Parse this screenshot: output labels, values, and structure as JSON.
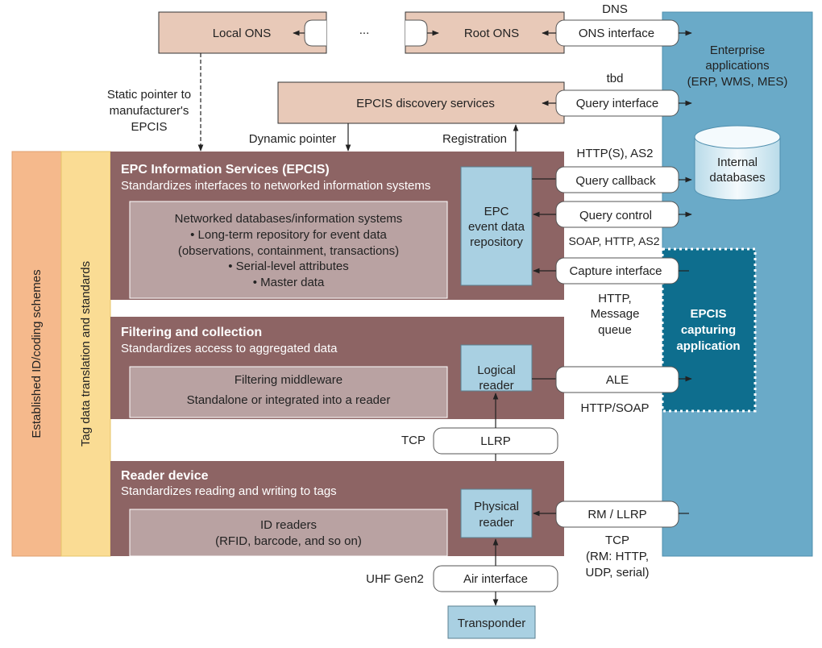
{
  "colors": {
    "ons_box": "#e8c9b8",
    "layer": "#8d6464",
    "inner_box": "#b9a2a2",
    "light_blue": "#a9d0e2",
    "enterprise_panel": "#6aaac8",
    "capturing_app": "#0e6e8e",
    "id_schemes_strip": "#f5b98c",
    "tag_translation_strip": "#fadc94"
  },
  "top": {
    "local_ons": "Local ONS",
    "ellipsis": "...",
    "root_ons": "Root ONS",
    "dns": "DNS",
    "ons_interface": "ONS interface",
    "discovery": "EPCIS discovery services",
    "tbd": "tbd",
    "query_interface": "Query interface",
    "static_pointer": [
      "Static pointer to",
      "manufacturer's",
      "EPCIS"
    ],
    "dynamic_pointer": "Dynamic pointer",
    "registration": "Registration"
  },
  "enterprise": {
    "lines": [
      "Enterprise",
      "applications",
      "(ERP, WMS, MES)"
    ],
    "internal_db": [
      "Internal",
      "databases"
    ],
    "capturing_app": [
      "EPCIS",
      "capturing",
      "application"
    ]
  },
  "side_strips": {
    "id_schemes": "Established ID/coding schemes",
    "tag_translation": "Tag data translation and standards"
  },
  "epcis_layer": {
    "title": "EPC Information Services (EPCIS)",
    "subtitle": "Standardizes interfaces to networked information systems",
    "inner": [
      "Networked databases/information systems",
      "• Long-term repository for event data",
      "(observations, containment, transactions)",
      "• Serial-level attributes",
      "• Master data"
    ],
    "repository": [
      "EPC",
      "event data",
      "repository"
    ],
    "http_as2": "HTTP(S), AS2",
    "query_callback": "Query callback",
    "query_control": "Query control",
    "soap_http_as2": "SOAP, HTTP, AS2",
    "capture_interface": "Capture interface",
    "http_mq": [
      "HTTP,",
      "Message",
      "queue"
    ]
  },
  "filtering_layer": {
    "title": "Filtering and collection",
    "subtitle": "Standardizes access to aggregated data",
    "inner": [
      "Filtering middleware",
      "Standalone or integrated into a reader"
    ],
    "logical_reader": [
      "Logical",
      "reader"
    ],
    "ale": "ALE",
    "http_soap": "HTTP/SOAP",
    "tcp": "TCP",
    "llrp": "LLRP"
  },
  "reader_layer": {
    "title": "Reader device",
    "subtitle": "Standardizes reading and writing to tags",
    "inner": [
      "ID readers",
      "(RFID, barcode, and so on)"
    ],
    "physical_reader": [
      "Physical",
      "reader"
    ],
    "rm_llrp": "RM / LLRP",
    "tcp_note": [
      "TCP",
      "(RM: HTTP,",
      "UDP, serial)"
    ],
    "uhf": "UHF Gen2",
    "air_interface": "Air interface",
    "transponder": "Transponder"
  }
}
